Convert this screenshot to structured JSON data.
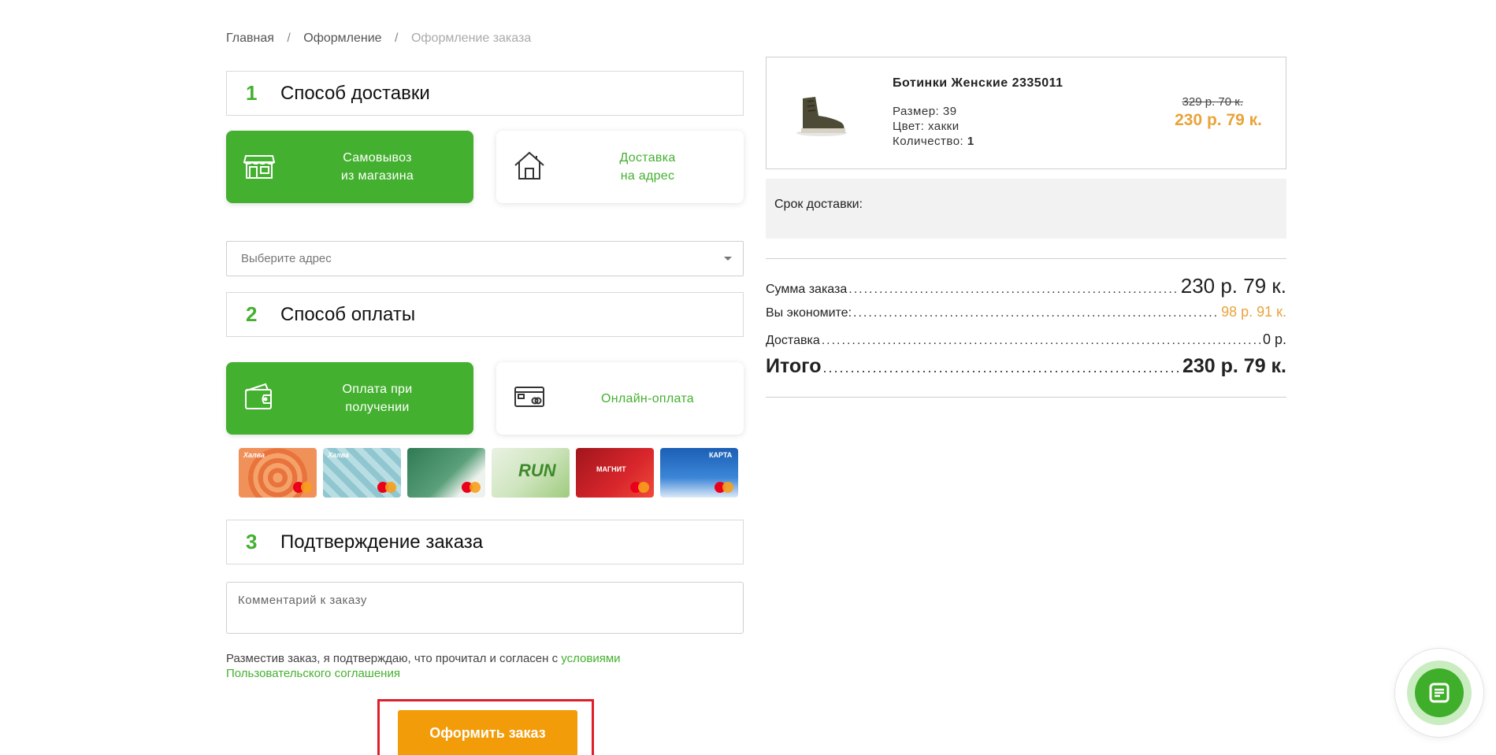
{
  "breadcrumb": {
    "items": [
      "Главная",
      "Оформление",
      "Оформление заказа"
    ],
    "separator": "/"
  },
  "sections": {
    "delivery": {
      "number": "1",
      "title": "Способ доставки"
    },
    "payment": {
      "number": "2",
      "title": "Способ оплаты"
    },
    "confirm": {
      "number": "3",
      "title": "Подтверждение заказа"
    }
  },
  "delivery_options": {
    "pickup": {
      "line1": "Самовывоз",
      "line2": "из магазина",
      "icon": "store-icon",
      "selected": true
    },
    "address": {
      "line1": "Доставка",
      "line2": "на адрес",
      "icon": "house-icon",
      "selected": false
    }
  },
  "address_select": {
    "placeholder": "Выберите адрес"
  },
  "payment_options": {
    "on_receipt": {
      "line1": "Оплата при",
      "line2": "получении",
      "icon": "wallet-icon",
      "selected": true
    },
    "online": {
      "label": "Онлайн-оплата",
      "icon": "bank-card-icon",
      "selected": false
    }
  },
  "payment_cards": [
    {
      "name": "halva-orange-card",
      "text": "Халва"
    },
    {
      "name": "halva-blue-card",
      "text": "Халва"
    },
    {
      "name": "priorbank-card",
      "text": ""
    },
    {
      "name": "bps-sberbank-run-card",
      "text": "RUN"
    },
    {
      "name": "magnit-card",
      "text": "МАГНИТ"
    },
    {
      "name": "karta-pokupok-card",
      "text": "КАРТА"
    }
  ],
  "comment": {
    "placeholder": "Комментарий к заказу"
  },
  "terms": {
    "text": "Разместив заказ, я подтверждаю, что прочитал и согласен с ",
    "link1": "условиями",
    "link2": "Пользовательского соглашения"
  },
  "submit": {
    "label": "Оформить заказ"
  },
  "product": {
    "name": "Ботинки Женские 2335011",
    "size": "Размер: 39",
    "color": "Цвет: хакки",
    "qty_label": "Количество: ",
    "qty_value": "1",
    "old_price": "329 р. 70 к.",
    "new_price": "230 р. 79 к."
  },
  "delivery_term": {
    "label": "Срок доставки:"
  },
  "summary": {
    "order_sum": {
      "label": "Сумма заказа",
      "value": "230 р. 79 к."
    },
    "savings": {
      "label": "Вы экономите:",
      "value": "98 р. 91 к."
    },
    "delivery": {
      "label": "Доставка",
      "value": "0 р."
    },
    "total": {
      "label": "Итого",
      "value": "230 р. 79 к."
    }
  },
  "colors": {
    "brand_green": "#44b02f",
    "price_orange": "#e8a33a",
    "button_orange": "#f39c0a",
    "highlight_red": "#e01e2a"
  },
  "chat_widget": {
    "icon": "chat-icon"
  }
}
